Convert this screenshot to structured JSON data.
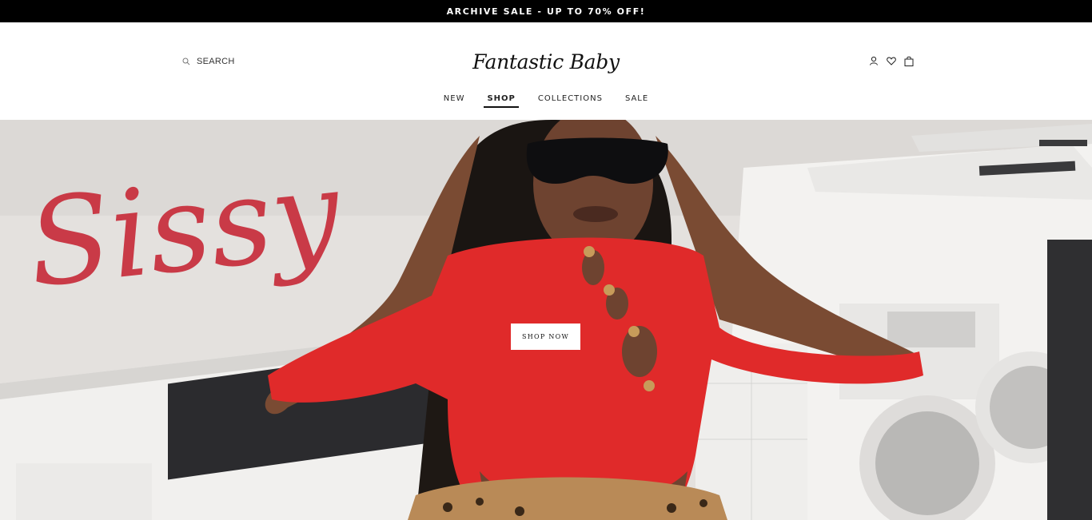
{
  "announcement": {
    "text": "ARCHIVE SALE - UP TO 70% OFF!"
  },
  "header": {
    "search_label": "SEARCH",
    "logo_text": "Fantastic Baby",
    "icons": [
      "account-icon",
      "wishlist-icon",
      "cart-icon"
    ]
  },
  "nav": {
    "items": [
      {
        "label": "NEW"
      },
      {
        "label": "SHOP",
        "active": true
      },
      {
        "label": "COLLECTIONS"
      },
      {
        "label": "SALE"
      }
    ]
  },
  "hero": {
    "script_text": "Sissy",
    "cta_label": "SHOP NOW"
  },
  "colors": {
    "announcement_bg": "#000000",
    "accent_red": "#c8323f",
    "garment_red": "#e02a2a"
  }
}
